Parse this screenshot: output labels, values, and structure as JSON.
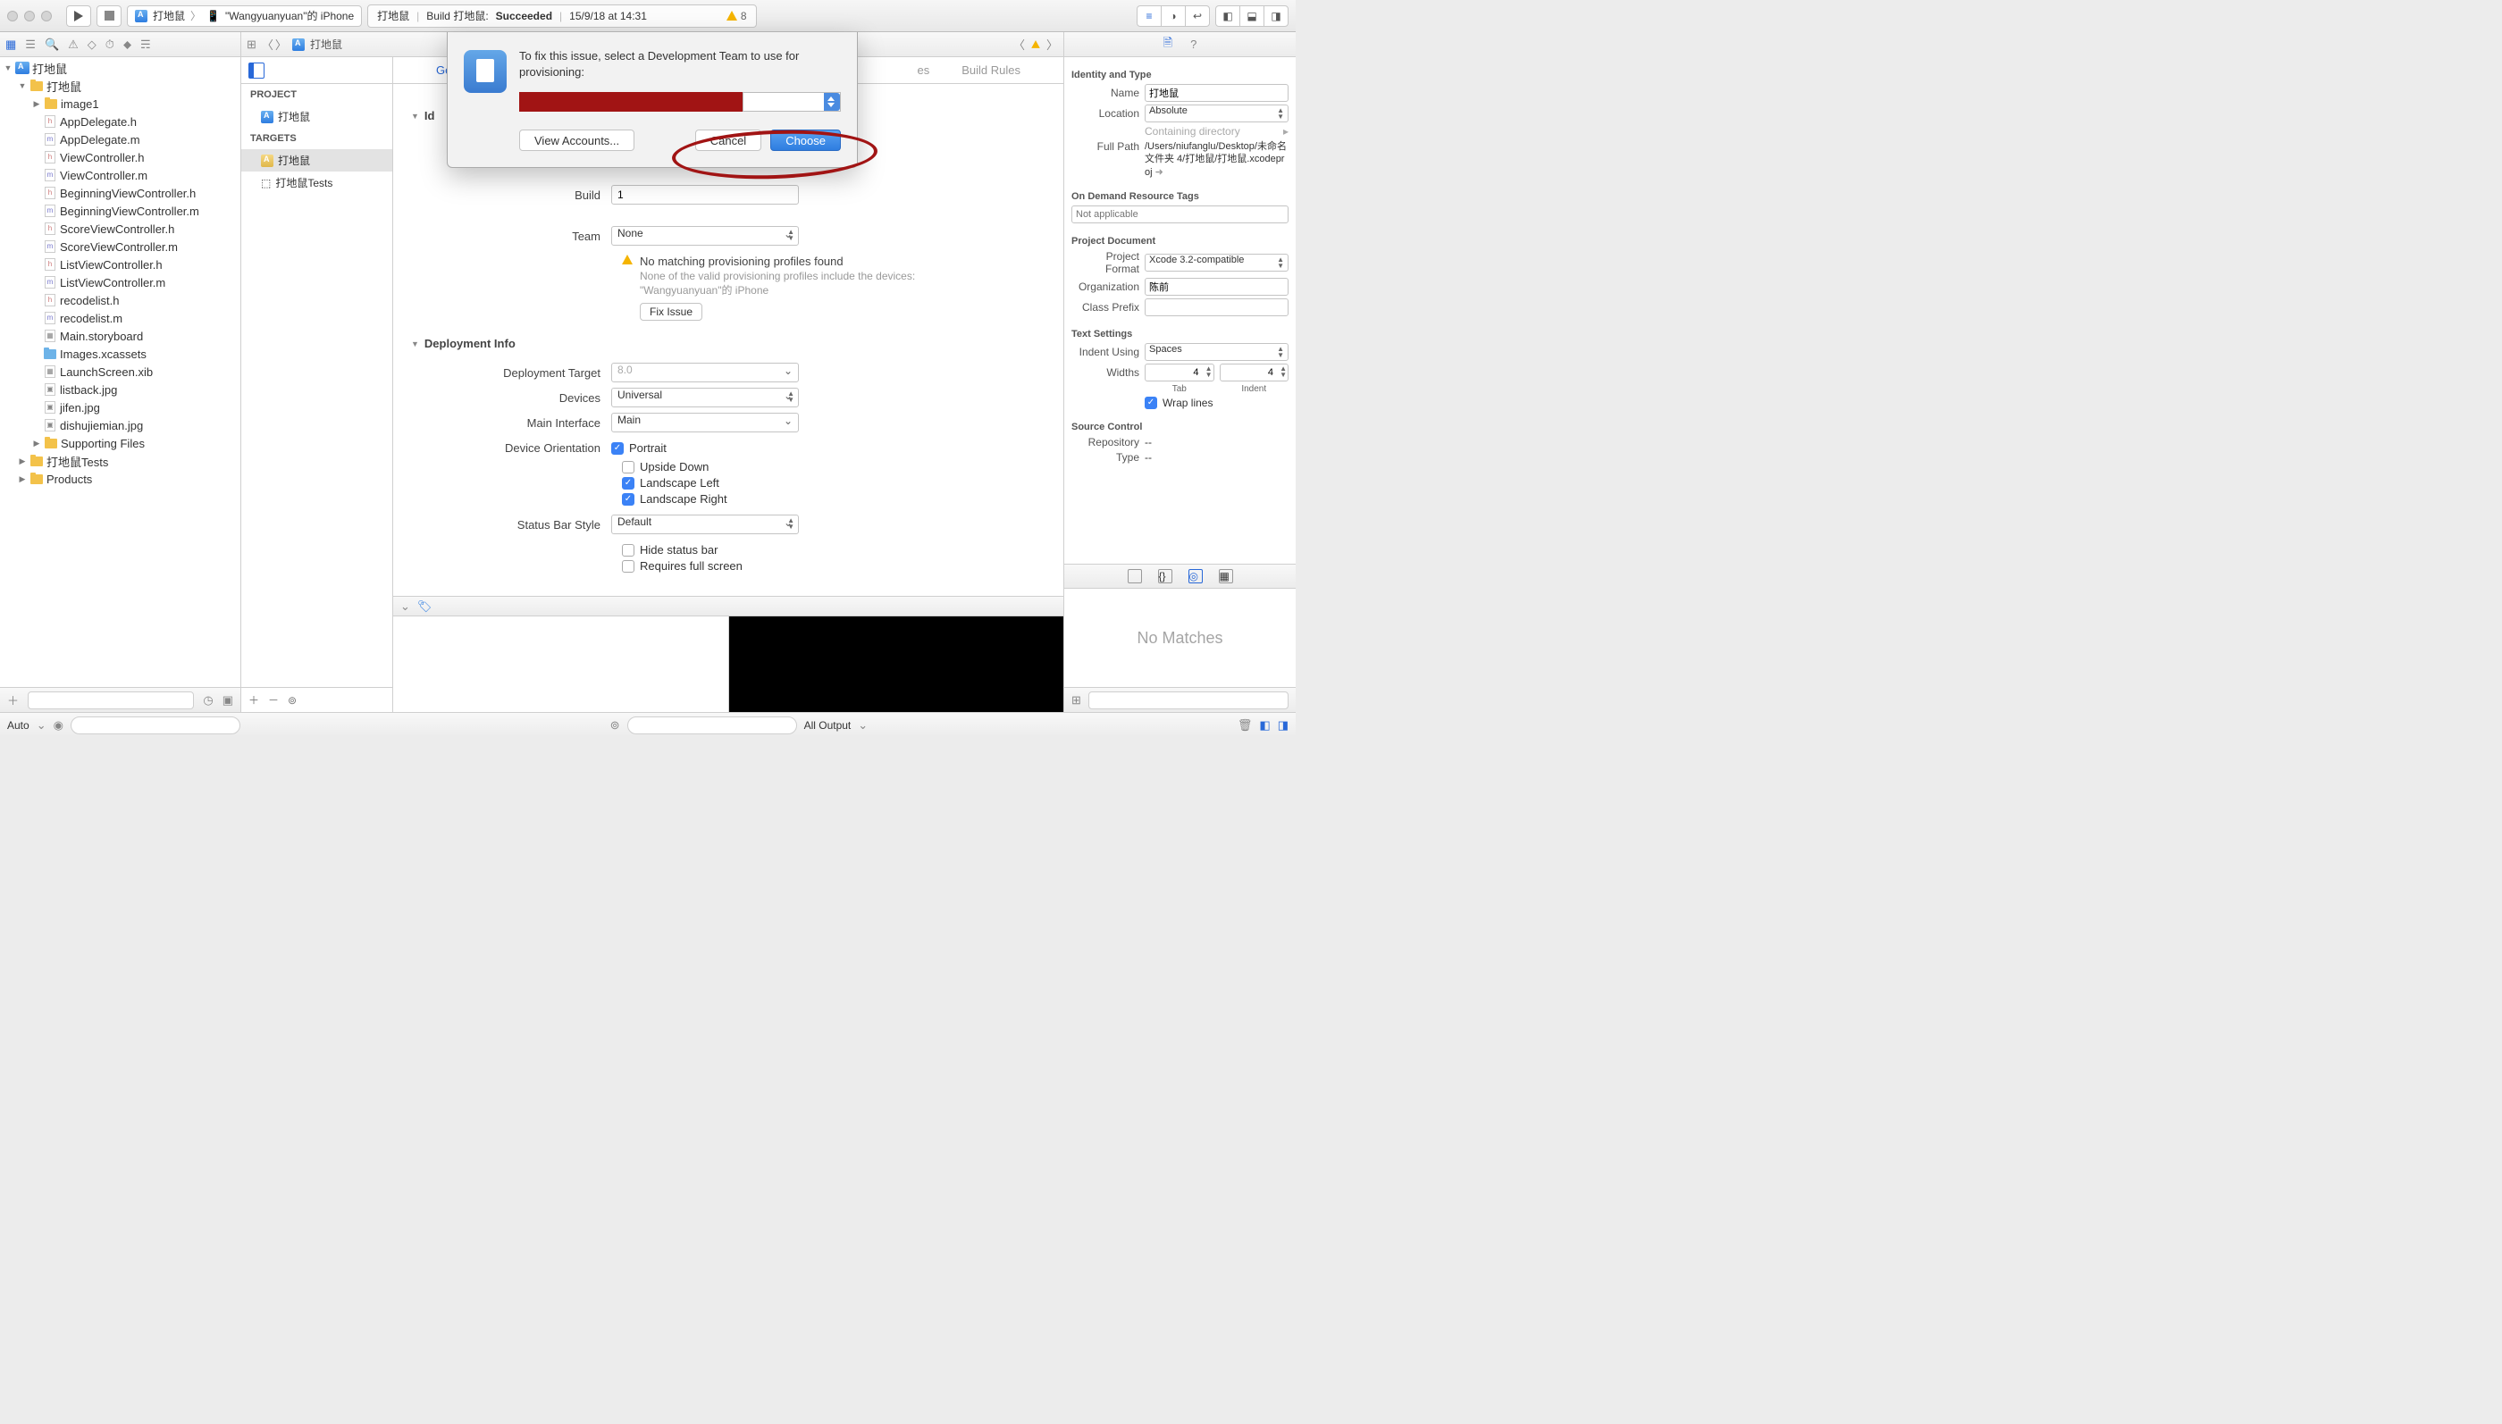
{
  "toolbar": {
    "scheme_target": "打地鼠",
    "scheme_device": "\"Wangyuanyuan\"的 iPhone",
    "status_project": "打地鼠",
    "status_action": "Build 打地鼠:",
    "status_result": "Succeeded",
    "status_time": "15/9/18 at 14:31",
    "warn_count": "8"
  },
  "jump": {
    "item": "打地鼠"
  },
  "navigator": {
    "root": "打地鼠",
    "group_main": "打地鼠",
    "folder_image": "image1",
    "files": {
      "appdelegate_h": "AppDelegate.h",
      "appdelegate_m": "AppDelegate.m",
      "viewcontroller_h": "ViewController.h",
      "viewcontroller_m": "ViewController.m",
      "beginning_h": "BeginningViewController.h",
      "beginning_m": "BeginningViewController.m",
      "score_h": "ScoreViewController.h",
      "score_m": "ScoreViewController.m",
      "list_h": "ListViewController.h",
      "list_m": "ListViewController.m",
      "recodelist_h": "recodelist.h",
      "recodelist_m": "recodelist.m",
      "storyboard": "Main.storyboard",
      "assets": "Images.xcassets",
      "launch": "LaunchScreen.xib",
      "listback": "listback.jpg",
      "jifen": "jifen.jpg",
      "dishu": "dishujiemian.jpg"
    },
    "folder_support": "Supporting Files",
    "group_tests": "打地鼠Tests",
    "group_products": "Products"
  },
  "projlist": {
    "project_hdr": "PROJECT",
    "project_item": "打地鼠",
    "targets_hdr": "TARGETS",
    "target_app": "打地鼠",
    "target_tests": "打地鼠Tests"
  },
  "tabs": {
    "general": "General",
    "build_rules": "Build Rules",
    "partial_es": "es"
  },
  "identity": {
    "section": "Identity",
    "section_short": "Id",
    "build_lbl": "Build",
    "build_val": "1",
    "team_lbl": "Team",
    "team_val": "None",
    "warn_title": "No matching provisioning profiles found",
    "warn_body": "None of the valid provisioning profiles include the devices: \"Wangyuanyuan\"的 iPhone",
    "fix_btn": "Fix Issue"
  },
  "deploy": {
    "section": "Deployment Info",
    "target_lbl": "Deployment Target",
    "target_val": "8.0",
    "devices_lbl": "Devices",
    "devices_val": "Universal",
    "main_lbl": "Main Interface",
    "main_val": "Main",
    "orient_lbl": "Device Orientation",
    "o_portrait": "Portrait",
    "o_upside": "Upside Down",
    "o_lleft": "Landscape Left",
    "o_lright": "Landscape Right",
    "status_lbl": "Status Bar Style",
    "status_val": "Default",
    "hide_status": "Hide status bar",
    "full_screen": "Requires full screen"
  },
  "modal": {
    "text": "To fix this issue, select a Development Team to use for provisioning:",
    "view_accounts": "View Accounts...",
    "cancel": "Cancel",
    "choose": "Choose"
  },
  "inspector": {
    "identity_hdr": "Identity and Type",
    "name_lbl": "Name",
    "name_val": "打地鼠",
    "location_lbl": "Location",
    "location_val": "Absolute",
    "containing": "Containing directory",
    "fullpath_lbl": "Full Path",
    "fullpath_val": "/Users/niufanglu/Desktop/未命名文件夹 4/打地鼠/打地鼠.xcodeproj",
    "odr_hdr": "On Demand Resource Tags",
    "odr_placeholder": "Not applicable",
    "projdoc_hdr": "Project Document",
    "projformat_lbl": "Project Format",
    "projformat_val": "Xcode 3.2-compatible",
    "org_lbl": "Organization",
    "org_val": "陈前",
    "classprefix_lbl": "Class Prefix",
    "classprefix_val": "",
    "text_hdr": "Text Settings",
    "indent_lbl": "Indent Using",
    "indent_val": "Spaces",
    "widths_lbl": "Widths",
    "tab_val": "4",
    "indent_w_val": "4",
    "tab_caption": "Tab",
    "indent_caption": "Indent",
    "wrap_lbl": "Wrap lines",
    "source_hdr": "Source Control",
    "repo_lbl": "Repository",
    "repo_val": "--",
    "type_lbl": "Type",
    "type_val": "--",
    "no_matches": "No Matches"
  },
  "bottom": {
    "auto": "Auto",
    "all_output": "All Output"
  }
}
